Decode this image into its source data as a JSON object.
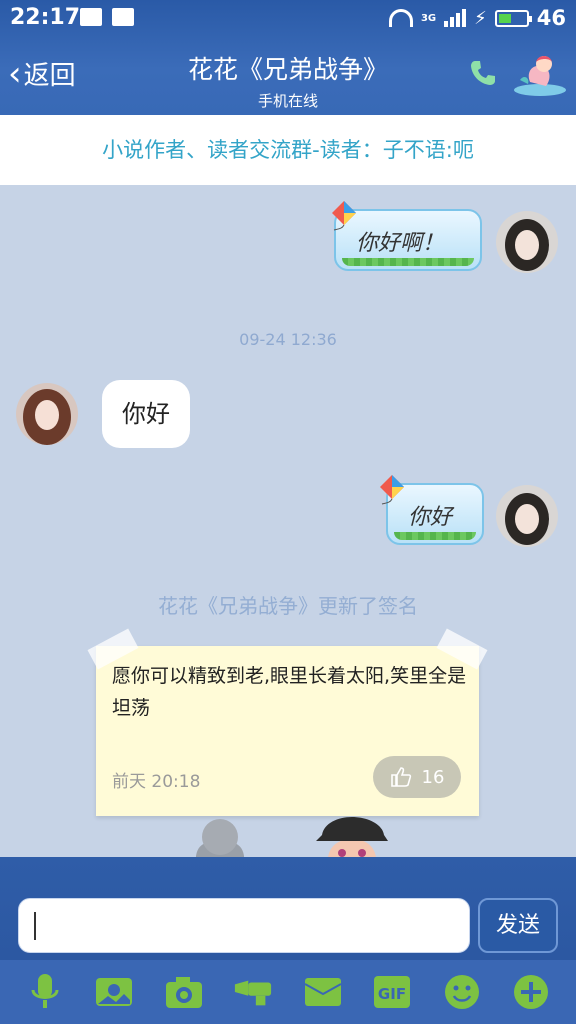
{
  "status_bar": {
    "time": "22:17",
    "network": "3G",
    "battery": "46"
  },
  "header": {
    "back_label": "返回",
    "title": "花花《兄弟战争》",
    "subtitle": "手机在线"
  },
  "group_notice": "小说作者、读者交流群-读者：子不语:呃",
  "messages": [
    {
      "side": "right",
      "text": "你好啊！",
      "style": "kite-bubble"
    },
    {
      "type": "timestamp",
      "text": "09-24 12:36"
    },
    {
      "side": "left",
      "text": "你好",
      "style": "plain-bubble"
    },
    {
      "side": "right",
      "text": "你好",
      "style": "kite-bubble"
    },
    {
      "type": "system",
      "text": "花花《兄弟战争》更新了签名"
    }
  ],
  "signature_card": {
    "text": "愿你可以精致到老,眼里长着太阳,笑里全是坦荡",
    "date": "前天 20:18",
    "likes": "16"
  },
  "composer": {
    "value": "",
    "send_label": "发送"
  },
  "toolbar": {
    "items": [
      "microphone-icon",
      "picture-icon",
      "camera-icon",
      "flashlight-icon",
      "envelope-icon",
      "gif-icon",
      "smiley-icon",
      "plus-icon"
    ],
    "gif_label": "GIF"
  },
  "colors": {
    "header": "#3468b4",
    "notice_text": "#33a4c8",
    "background": "#c6d3e6",
    "accent_green": "#7dc242"
  }
}
